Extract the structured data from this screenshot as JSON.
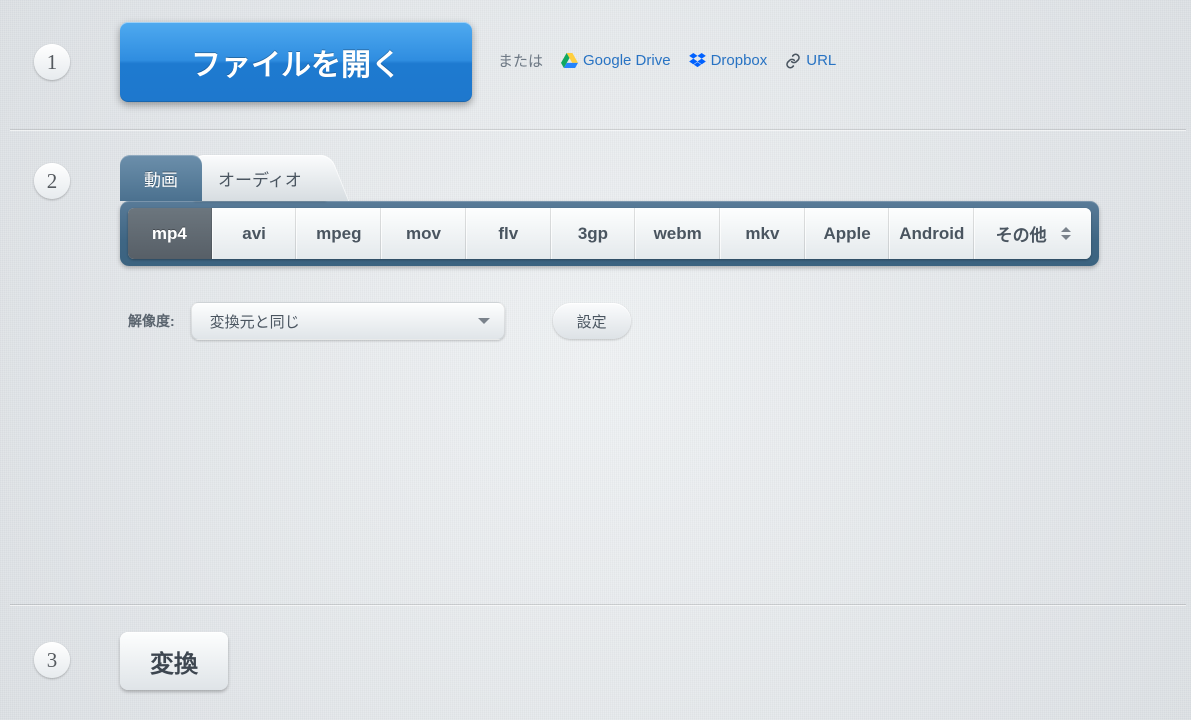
{
  "step1": {
    "number": "1",
    "open_file_label": "ファイルを開く",
    "or_label": "または",
    "sources": {
      "gdrive": "Google Drive",
      "dropbox": "Dropbox",
      "url": "URL"
    }
  },
  "step2": {
    "number": "2",
    "tabs": {
      "video": "動画",
      "audio": "オーディオ"
    },
    "formats": [
      "mp4",
      "avi",
      "mpeg",
      "mov",
      "flv",
      "3gp",
      "webm",
      "mkv",
      "Apple",
      "Android"
    ],
    "formats_other": "その他",
    "selected_format": "mp4",
    "resolution_label": "解像度:",
    "resolution_value": "変換元と同じ",
    "settings_label": "設定"
  },
  "step3": {
    "number": "3",
    "convert_label": "変換"
  }
}
